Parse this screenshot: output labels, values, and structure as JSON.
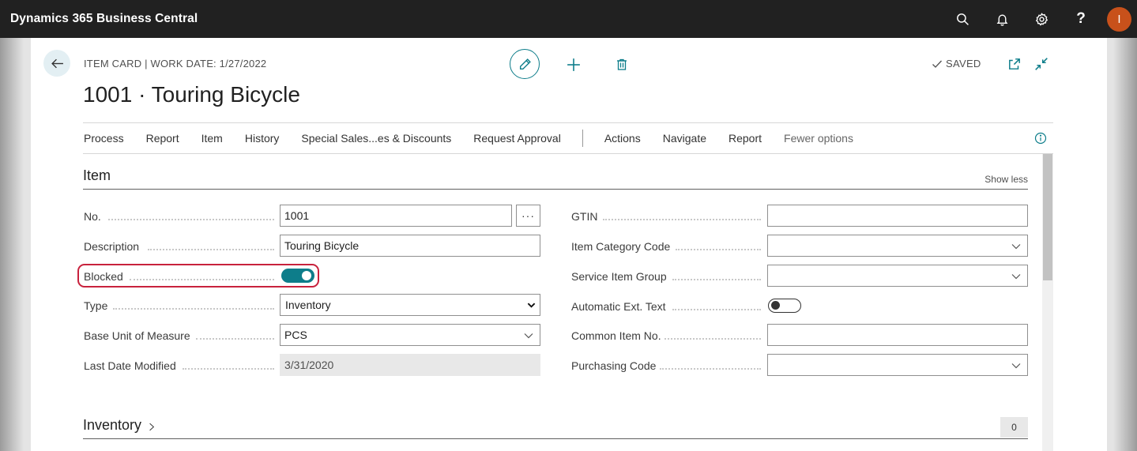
{
  "app": {
    "title": "Dynamics 365 Business Central",
    "avatar_initial": "I"
  },
  "topbar": {
    "icons": [
      "search-icon",
      "bell-icon",
      "gear-icon",
      "help-icon"
    ],
    "help_glyph": "?"
  },
  "header": {
    "caption": "ITEM CARD | WORK DATE: 1/27/2022",
    "title": "1001 · Touring Bicycle",
    "saved_label": "SAVED"
  },
  "actionbar": {
    "items": [
      "Process",
      "Report",
      "Item",
      "History",
      "Special Sales...es & Discounts",
      "Request Approval"
    ],
    "items2": [
      "Actions",
      "Navigate",
      "Report",
      "Fewer options"
    ]
  },
  "section_item": {
    "title": "Item",
    "show_less": "Show less"
  },
  "fields_left": [
    {
      "label": "No.",
      "value": "1001",
      "assist": "···"
    },
    {
      "label": "Description",
      "value": "Touring Bicycle"
    },
    {
      "label": "Blocked",
      "toggle": true
    },
    {
      "label": "Type",
      "value": "Inventory"
    },
    {
      "label": "Base Unit of Measure",
      "value": "PCS"
    },
    {
      "label": "Last Date Modified",
      "value": "3/31/2020"
    }
  ],
  "fields_right": [
    {
      "label": "GTIN",
      "value": ""
    },
    {
      "label": "Item Category Code",
      "value": ""
    },
    {
      "label": "Service Item Group",
      "value": ""
    },
    {
      "label": "Automatic Ext. Text",
      "toggle": false
    },
    {
      "label": "Common Item No.",
      "value": ""
    },
    {
      "label": "Purchasing Code",
      "value": ""
    }
  ],
  "section_inventory": {
    "title": "Inventory",
    "count": "0"
  },
  "colors": {
    "accent": "#0d7d8a",
    "highlight": "#c8223d",
    "topbar": "#212121",
    "avatar": "#c8511b"
  }
}
